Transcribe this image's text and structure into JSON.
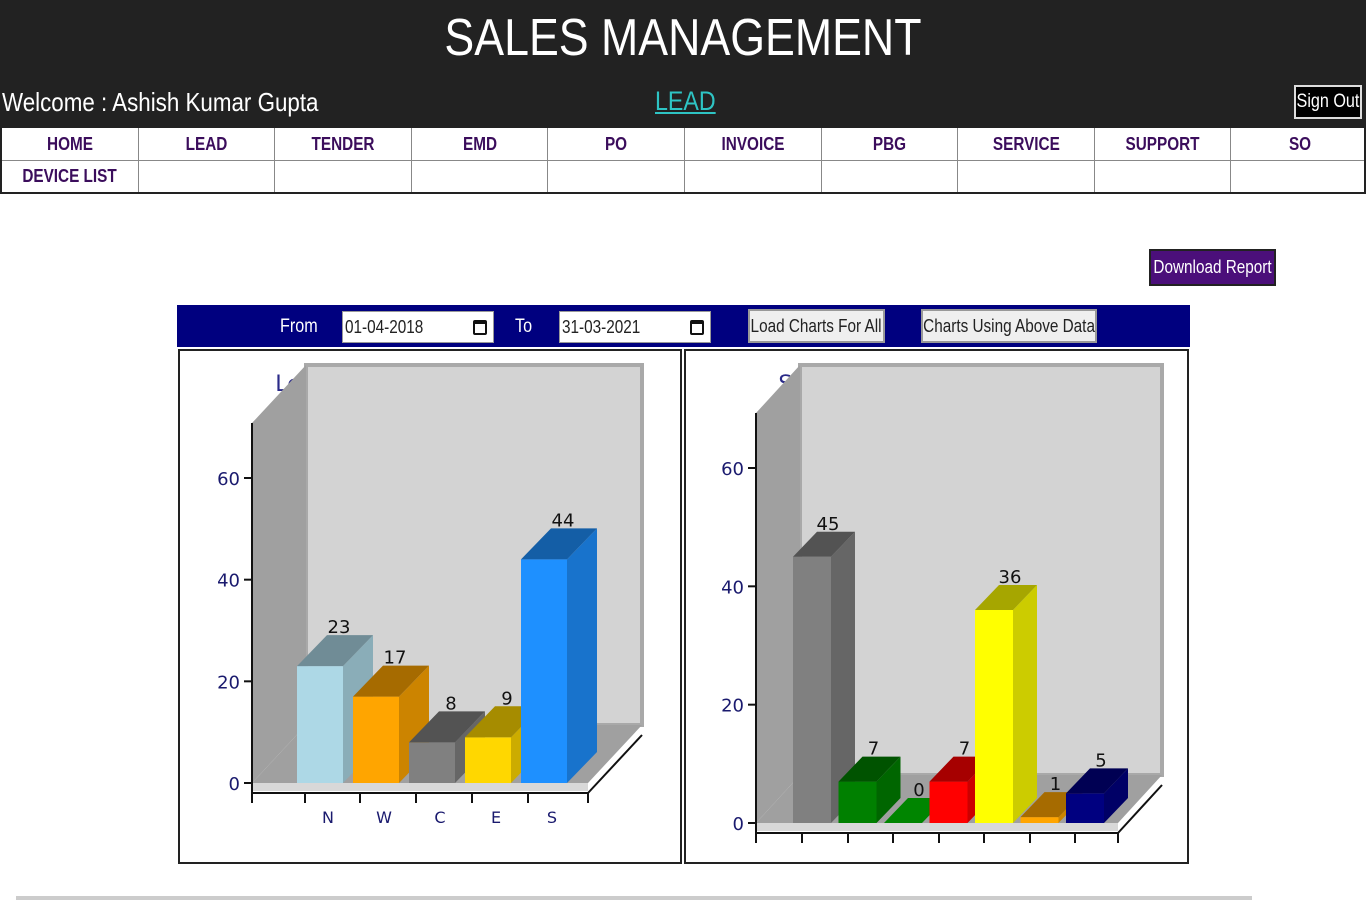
{
  "app": {
    "title": "SALES MANAGEMENT",
    "welcome": "Welcome : Ashish Kumar Gupta",
    "current_section": "LEAD",
    "signout_label": "Sign Out"
  },
  "nav": {
    "row1": [
      "HOME",
      "LEAD",
      "TENDER",
      "EMD",
      "PO",
      "INVOICE",
      "PBG",
      "SERVICE",
      "SUPPORT",
      "SO"
    ],
    "row2": [
      "DEVICE LIST"
    ]
  },
  "download_label": "Download Report",
  "filters": {
    "from_label": "From",
    "from_value": "01-04-2018",
    "to_label": "To",
    "to_value": "31-03-2021",
    "load_all_label": "Load Charts For All",
    "using_data_label": "Charts Using Above Data"
  },
  "colors": {
    "header_bg": "#222222",
    "nav_text": "#3b0d5c",
    "filter_bar": "#00007f",
    "download_bg": "#4b0f7a",
    "link": "#2ec4c4"
  },
  "chart_data": [
    {
      "type": "bar",
      "title": "Leads % (Using Above Data)",
      "categories": [
        "N",
        "W",
        "C",
        "E",
        "S"
      ],
      "values": [
        23,
        17,
        8,
        9,
        44
      ],
      "colors": [
        "#add8e6",
        "#ffa500",
        "#808080",
        "#ffd700",
        "#1e90ff"
      ],
      "ylim": [
        0,
        60
      ],
      "yticks": [
        0,
        20,
        40,
        60
      ],
      "style": "3d"
    },
    {
      "type": "bar",
      "title": "Status % (Using Above Data)",
      "categories": [
        "",
        "",
        "",
        "",
        "",
        "",
        "",
        ""
      ],
      "values": [
        45,
        7,
        0,
        7,
        36,
        1,
        5
      ],
      "colors": [
        "#808080",
        "#008000",
        "#00cc00",
        "#ff0000",
        "#ffff00",
        "#ffa500",
        "#000080"
      ],
      "ylim": [
        0,
        60
      ],
      "yticks": [
        0,
        20,
        40,
        60
      ],
      "style": "3d"
    }
  ]
}
